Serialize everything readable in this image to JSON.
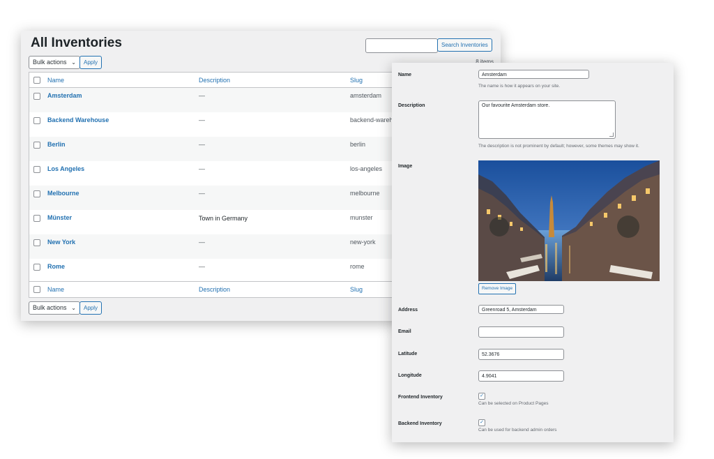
{
  "list": {
    "title": "All Inventories",
    "search_placeholder": "",
    "search_button": "Search Inventories",
    "bulk_actions": "Bulk actions",
    "apply": "Apply",
    "items_count": "8 items",
    "columns": {
      "name": "Name",
      "description": "Description",
      "slug": "Slug"
    },
    "rows": [
      {
        "name": "Amsterdam",
        "description": "—",
        "slug": "amsterdam"
      },
      {
        "name": "Backend Warehouse",
        "description": "—",
        "slug": "backend-wareho"
      },
      {
        "name": "Berlin",
        "description": "—",
        "slug": "berlin"
      },
      {
        "name": "Los Angeles",
        "description": "—",
        "slug": "los-angeles"
      },
      {
        "name": "Melbourne",
        "description": "—",
        "slug": "melbourne"
      },
      {
        "name": "Münster",
        "description": "Town in Germany",
        "slug": "munster"
      },
      {
        "name": "New York",
        "description": "—",
        "slug": "new-york"
      },
      {
        "name": "Rome",
        "description": "—",
        "slug": "rome"
      }
    ]
  },
  "form": {
    "name": {
      "label": "Name",
      "value": "Amsterdam",
      "help": "The name is how it appears on your site."
    },
    "description": {
      "label": "Description",
      "value": "Our favourite Amsterdam store.",
      "help": "The description is not prominent by default; however, some themes may show it."
    },
    "image": {
      "label": "Image",
      "remove_button": "Remove Image"
    },
    "address": {
      "label": "Address",
      "value": "Greenroad 5, Amsterdam"
    },
    "email": {
      "label": "Email",
      "value": ""
    },
    "latitude": {
      "label": "Latitude",
      "value": "52.3676"
    },
    "longitude": {
      "label": "Longitude",
      "value": "4.9041"
    },
    "frontend": {
      "label": "Frontend Inventory",
      "checked": true,
      "help": "Can be selected on Product Pages"
    },
    "backend": {
      "label": "Backend Inventory",
      "checked": true,
      "help": "Can be used for backend admin orders"
    }
  },
  "icons": {
    "dropdown": "chevron-down-icon",
    "check": "checkmark-icon"
  },
  "colors": {
    "link": "#2271b1",
    "panel_bg": "#f0f0f1",
    "row_alt": "#f6f7f7"
  }
}
